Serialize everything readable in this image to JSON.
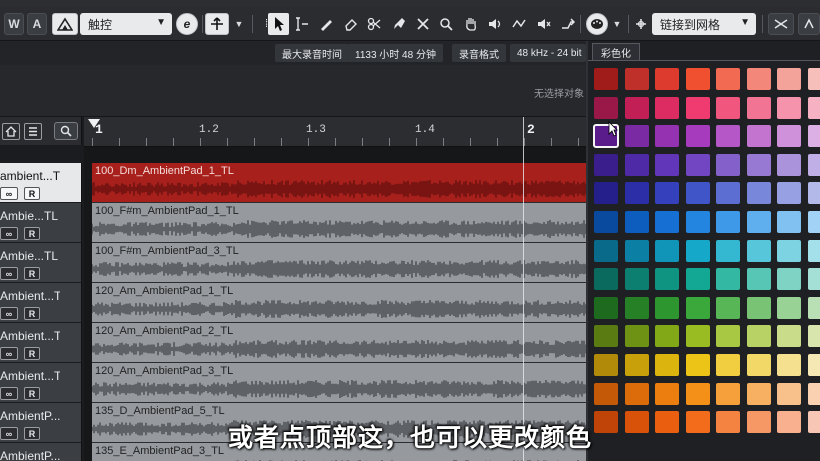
{
  "toolbar": {
    "btn_w": "W",
    "btn_a": "A",
    "mode_dropdown": "触控",
    "e_button": "e",
    "snap_dropdown": "链接到网格"
  },
  "info_bar": {
    "max_rec_label": "最大录音时间",
    "max_rec_value": "1133 小时 48 分钟",
    "rec_format_label": "录音格式",
    "rec_format_value": "48 kHz - 24 bit"
  },
  "status": {
    "text": "无选择对象"
  },
  "ruler": {
    "labels": [
      "1",
      "1.2",
      "1.3",
      "1.4",
      "2"
    ]
  },
  "tracks": [
    {
      "name": "ambient...TL",
      "clip": "100_Dm_AmbientPad_1_TL",
      "selected": true
    },
    {
      "name": "Ambie...TL",
      "clip": "100_F#m_AmbientPad_1_TL",
      "selected": false
    },
    {
      "name": "Ambie...TL",
      "clip": "100_F#m_AmbientPad_3_TL",
      "selected": false
    },
    {
      "name": "Ambient...TL",
      "clip": "120_Am_AmbientPad_1_TL",
      "selected": false
    },
    {
      "name": "Ambient...TL",
      "clip": "120_Am_AmbientPad_2_TL",
      "selected": false
    },
    {
      "name": "Ambient...TL",
      "clip": "120_Am_AmbientPad_3_TL",
      "selected": false
    },
    {
      "name": "AmbientP...TL",
      "clip": "135_D_AmbientPad_5_TL",
      "selected": false
    },
    {
      "name": "AmbientP...TL",
      "clip": "135_E_AmbientPad_3_TL",
      "selected": false
    }
  ],
  "track_buttons": {
    "link": "∞",
    "read": "R"
  },
  "color_popup": {
    "tab_label": "彩色化",
    "rows": [
      [
        "#a01c1a",
        "#c0302a",
        "#dd3b2e",
        "#f0502f",
        "#f26a52",
        "#f2877a",
        "#f4a39b",
        "#f6bfb9"
      ],
      [
        "#9a1848",
        "#c21f56",
        "#dd2c62",
        "#ef3b6f",
        "#f1567f",
        "#f27494",
        "#f493ab",
        "#f6b2c3"
      ],
      [
        "#5a1c8a",
        "#7a2aa2",
        "#9432b2",
        "#a63cbd",
        "#b557c6",
        "#c274cf",
        "#cf92da",
        "#dcb0e4"
      ],
      [
        "#3a1e8c",
        "#4f2aa6",
        "#6236b8",
        "#7246c2",
        "#8460ca",
        "#9779d3",
        "#ab93dc",
        "#c0aee6"
      ],
      [
        "#241f8a",
        "#2c2ea8",
        "#3440bc",
        "#4055c8",
        "#5c6ed2",
        "#7987da",
        "#96a0e2",
        "#b3bae9"
      ],
      [
        "#0a4a9e",
        "#0d5dbe",
        "#1670d4",
        "#2385e0",
        "#3e9ae8",
        "#5faeee",
        "#80c1f2",
        "#a2d3f6"
      ],
      [
        "#0a6a8a",
        "#0c7fa4",
        "#1094b8",
        "#15a8c8",
        "#34b8d2",
        "#58c6da",
        "#7ed3e2",
        "#a3e0ea"
      ],
      [
        "#0a6a5e",
        "#0c7f70",
        "#0f9482",
        "#13a894",
        "#33b8a4",
        "#57c6b4",
        "#7ed3c5",
        "#a5e0d6"
      ],
      [
        "#1e6a1e",
        "#258026",
        "#2e962e",
        "#3aa83a",
        "#58b656",
        "#78c474",
        "#98d294",
        "#b8e0b4"
      ],
      [
        "#5a7a12",
        "#6e9214",
        "#82a818",
        "#98bc22",
        "#a8c844",
        "#b8d266",
        "#c8dc8a",
        "#d8e6ae"
      ],
      [
        "#b08a08",
        "#c8a00a",
        "#dcb40e",
        "#ecc418",
        "#f0ce40",
        "#f2d866",
        "#f4e08e",
        "#f6e8b4"
      ],
      [
        "#c45a08",
        "#dc6c0a",
        "#ec7e10",
        "#f49018",
        "#f6a03c",
        "#f7b062",
        "#f8c08a",
        "#fad2b2"
      ],
      [
        "#c04408",
        "#d8520a",
        "#ea5e10",
        "#f26c1c",
        "#f48240",
        "#f69866",
        "#f8b08e",
        "#f8c6b4"
      ]
    ],
    "selected_color": "#5a1c8a"
  },
  "subtitle": "或者点顶部这，也可以更改颜色"
}
